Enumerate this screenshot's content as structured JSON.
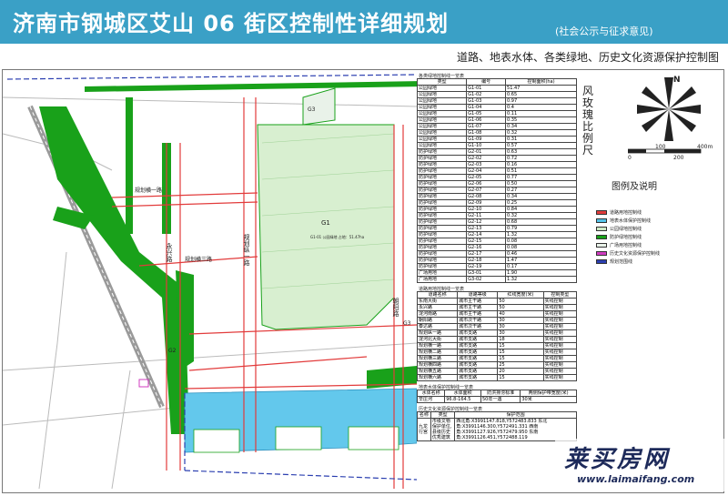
{
  "header": {
    "title": "济南市钢城区艾山 06 街区控制性详细规划",
    "note": "(社会公示与征求意见)",
    "subtitle": "道路、地表水体、各类绿地、历史文化资源保护控制图"
  },
  "side": {
    "vertical_title": "风玫瑰比例尺",
    "legend_title": "图例及说明",
    "north": "N",
    "scale_ticks": [
      "0",
      "100",
      "200",
      "400m"
    ]
  },
  "legend": [
    {
      "label": "道路用地控制线",
      "color": "#e23b3b"
    },
    {
      "label": "地表水体保护控制线",
      "color": "#55c2e8"
    },
    {
      "label": "公园绿地控制线",
      "color": "#cfe9c7"
    },
    {
      "label": "防护绿地控制线",
      "color": "#19a11a"
    },
    {
      "label": "广场用地控制线",
      "color": "#e9f2e9"
    },
    {
      "label": "历史文化资源保护控制线",
      "color": "#d03cc0"
    },
    {
      "label": "规划范围线",
      "color": "#2b3fb0"
    }
  ],
  "greens_table": {
    "title": "各类绿地控制线一览表",
    "headers": [
      "类型",
      "编号",
      "控制面积(ha)"
    ],
    "rows": [
      [
        "公园绿地",
        "G1-01",
        "51.47"
      ],
      [
        "公园绿地",
        "G1-02",
        "0.65"
      ],
      [
        "公园绿地",
        "G1-03",
        "0.97"
      ],
      [
        "公园绿地",
        "G1-04",
        "0.4"
      ],
      [
        "公园绿地",
        "G1-05",
        "0.11"
      ],
      [
        "公园绿地",
        "G1-06",
        "0.35"
      ],
      [
        "公园绿地",
        "G1-07",
        "0.34"
      ],
      [
        "公园绿地",
        "G1-08",
        "0.32"
      ],
      [
        "公园绿地",
        "G1-09",
        "0.31"
      ],
      [
        "公园绿地",
        "G1-10",
        "0.57"
      ],
      [
        "防护绿地",
        "G2-01",
        "0.63"
      ],
      [
        "防护绿地",
        "G2-02",
        "0.72"
      ],
      [
        "防护绿地",
        "G2-03",
        "0.16"
      ],
      [
        "防护绿地",
        "G2-04",
        "0.51"
      ],
      [
        "防护绿地",
        "G2-05",
        "0.77"
      ],
      [
        "防护绿地",
        "G2-06",
        "0.50"
      ],
      [
        "防护绿地",
        "G2-07",
        "0.27"
      ],
      [
        "防护绿地",
        "G2-08",
        "0.34"
      ],
      [
        "防护绿地",
        "G2-09",
        "0.25"
      ],
      [
        "防护绿地",
        "G2-10",
        "0.84"
      ],
      [
        "防护绿地",
        "G2-11",
        "0.32"
      ],
      [
        "防护绿地",
        "G2-12",
        "0.68"
      ],
      [
        "防护绿地",
        "G2-13",
        "0.79"
      ],
      [
        "防护绿地",
        "G2-14",
        "1.32"
      ],
      [
        "防护绿地",
        "G2-15",
        "0.08"
      ],
      [
        "防护绿地",
        "G2-16",
        "0.08"
      ],
      [
        "防护绿地",
        "G2-17",
        "0.46"
      ],
      [
        "防护绿地",
        "G2-18",
        "1.47"
      ],
      [
        "防护绿地",
        "G2-19",
        "0.17"
      ],
      [
        "广场用地",
        "G3-01",
        "1.90"
      ],
      [
        "广场用地",
        "G3-02",
        "1.32"
      ]
    ]
  },
  "roads_table": {
    "title": "道路用地控制线一览表",
    "headers": [
      "道路名称",
      "道路等级",
      "红线宽度(米)",
      "控制类型"
    ],
    "rows": [
      [
        "东南大街",
        "城市主干路",
        "50",
        "实线控制"
      ],
      [
        "永兴路",
        "城市主干路",
        "50",
        "实线控制"
      ],
      [
        "淀河南路",
        "城市主干路",
        "40",
        "实线控制"
      ],
      [
        "朝阳路",
        "城市次干路",
        "30",
        "实线控制"
      ],
      [
        "泰达路",
        "城市次干路",
        "30",
        "实线控制"
      ],
      [
        "规划纵一路",
        "城市支路",
        "30",
        "实线控制"
      ],
      [
        "淀河北大街",
        "城市支路",
        "18",
        "实线控制"
      ],
      [
        "规划横一路",
        "城市支路",
        "15",
        "实线控制"
      ],
      [
        "规划横二路",
        "城市支路",
        "15",
        "实线控制"
      ],
      [
        "规划横三路",
        "城市支路",
        "15",
        "实线控制"
      ],
      [
        "规划横四路",
        "城市支路",
        "25",
        "实线控制"
      ],
      [
        "规划横五路",
        "城市支路",
        "20",
        "实线控制"
      ],
      [
        "规划横六路",
        "城市支路",
        "15",
        "实线控制"
      ]
    ]
  },
  "water_table": {
    "title": "地表水体保护控制线一览表",
    "headers": [
      "水体名称",
      "水体面积",
      "防洪排涝标准",
      "两侧保护带宽度(米)"
    ],
    "rows": [
      [
        "辛庄河",
        "96.8-164.5",
        "50年一遇",
        "30米"
      ]
    ]
  },
  "heritage_table": {
    "title": "历史文化资源保护控制线一览表",
    "headers": [
      "名称",
      "类型",
      "保护范围"
    ],
    "rows": [
      [
        "九龙行宫",
        "市级文物保护单位,县级历史优秀建筑",
        "西北角:X3991147.818,Y572483.833 东北角:X3991146.300,Y572491.331 西南角:X3991127.926,Y572479.950 东南角:X3991126.451,Y572488.119"
      ]
    ]
  },
  "map_labels": {
    "roads": [
      "永兴路",
      "规划纵一路",
      "朝阳路",
      "规划横一路",
      "规划横三路",
      "规划横四路",
      "规划横五路",
      "东南大街",
      "淀河南路"
    ],
    "zones": [
      {
        "id": "G1",
        "text": "G1-01\n公园绿地\n占地：51.47ha"
      },
      {
        "id": "G3",
        "text": "G3-01\n广场用地\n占地：1.90ha"
      },
      {
        "id": "G3b",
        "text": "G3-02\n广场用地\n占地：1.32ha"
      }
    ],
    "small": [
      "G2-05 防护绿地 占地：0.63ha",
      "G2-02 防护绿地 占地：0.72ha",
      "G2-04 防护绿地 占地：0.51ha",
      "G1-06 公园绿地 占地：0.11ha",
      "G2-07 防护绿地 占地：0.27ha",
      "G1-04 公园绿地 占地：0.40ha",
      "G2-06 防护绿地 占地：0.34ha",
      "G1-03 公园绿地 占地：0.97ha",
      "G2-09 防护绿地 占地：0.25ha",
      "G1-07 公园绿地 占地：0.35ha",
      "G2-14 防护绿地 占地：1.32ha",
      "G2-15 防护绿地 占地：0.08ha",
      "G2-17 防护绿地 占地：0.46ha",
      "G2-11 防护绿地 占地：0.22ha"
    ]
  },
  "watermark": {
    "brand": "莱买房网",
    "url": "www.laimaifang.com"
  },
  "colors": {
    "header": "#3aa0c6",
    "park": "#d8efd0",
    "protect": "#19a11a",
    "water": "#63c8ec",
    "road": "#e23b3b",
    "boundary": "#2b3fb0",
    "heritage": "#d03cc0"
  }
}
